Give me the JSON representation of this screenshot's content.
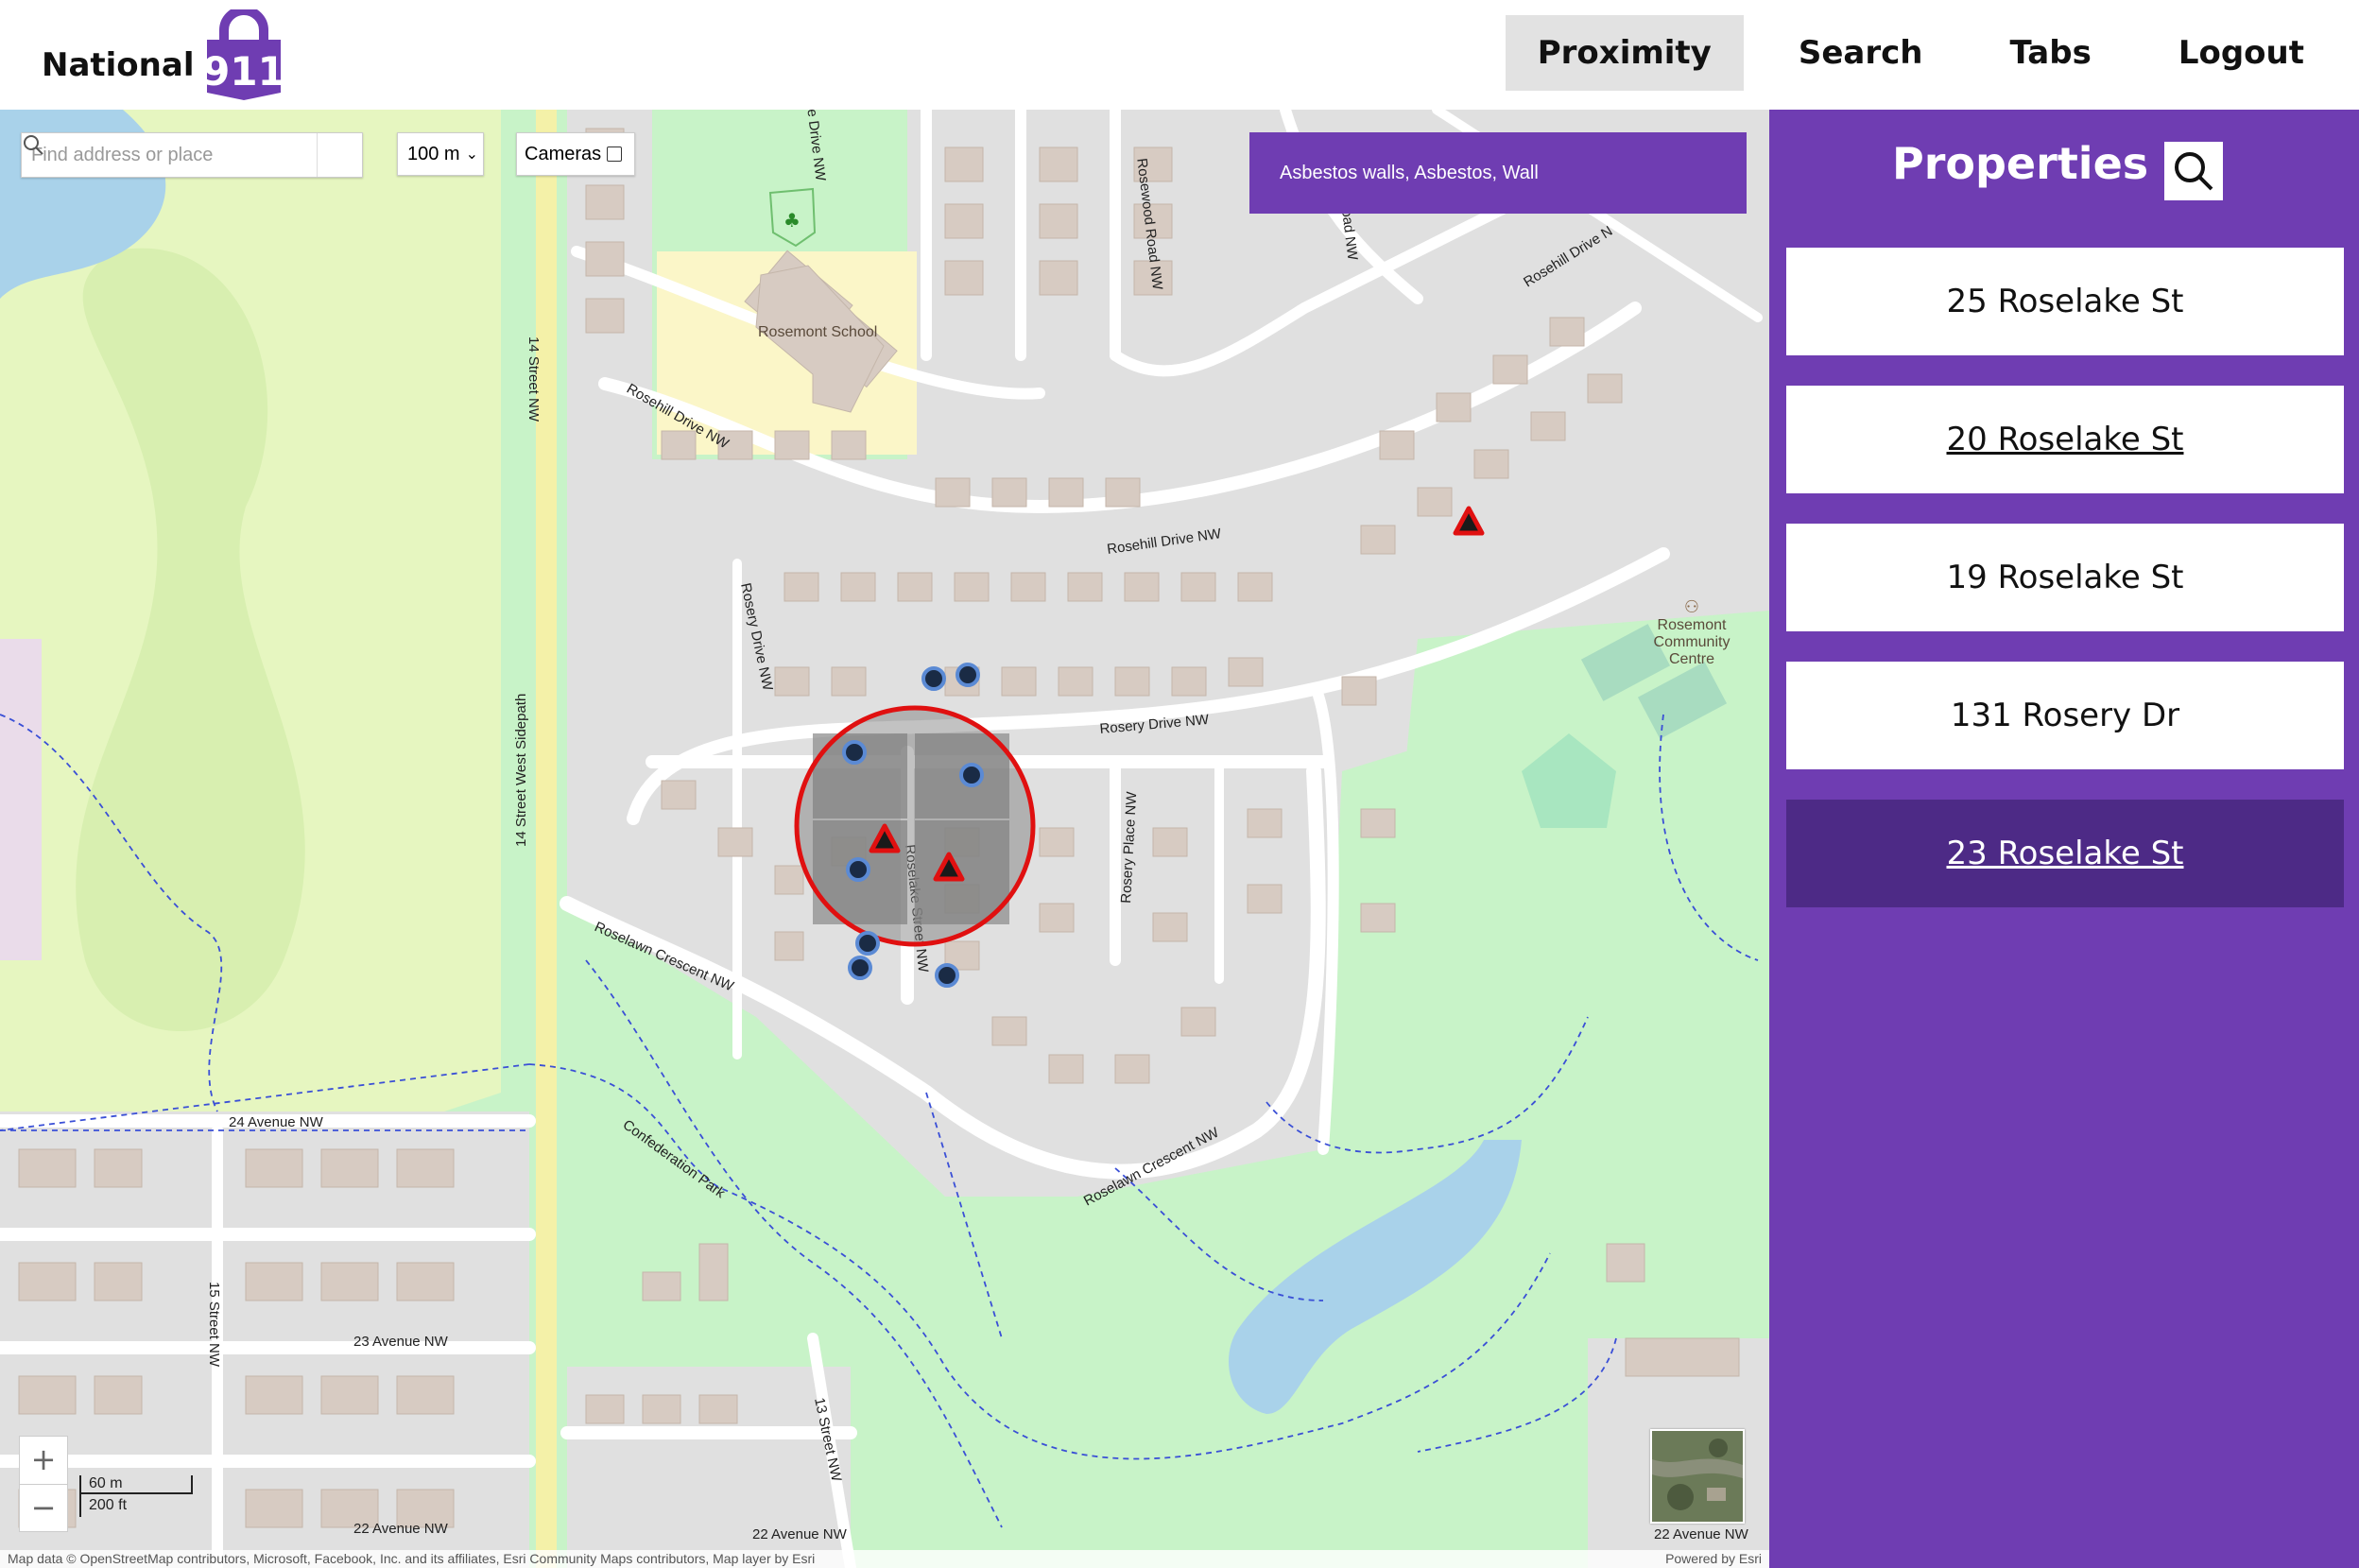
{
  "header": {
    "brand_text": "National",
    "brand_number": "911",
    "nav": [
      {
        "label": "Proximity",
        "active": true
      },
      {
        "label": "Search",
        "active": false
      },
      {
        "label": "Tabs",
        "active": false
      },
      {
        "label": "Logout",
        "active": false
      }
    ]
  },
  "map": {
    "search_placeholder": "Find address or place",
    "radius": "100 m",
    "cameras_label": "Cameras",
    "cameras_checked": false,
    "tooltip": "Asbestos walls, Asbestos, Wall",
    "zoom_in": "+",
    "zoom_out": "−",
    "scale_metric": "60 m",
    "scale_imperial": "200 ft",
    "attribution": "Map data © OpenStreetMap contributors, Microsoft, Facebook, Inc. and its affiliates, Esri Community Maps contributors, Map layer by Esri",
    "powered_by": "Powered by Esri",
    "labels": {
      "rosemont_school": "Rosemont School",
      "rosemont_centre_1": "Rosemont",
      "rosemont_centre_2": "Community",
      "rosemont_centre_3": "Centre",
      "confederation_park": "Confederation Park",
      "roselake_street": "Roselake Street NW",
      "rosery_drive_h": "Rosery Drive NW",
      "rosery_drive_v": "Rosery Drive NW",
      "rosehill_drive_1": "Rosehill Drive NW",
      "rosehill_drive_2": "Rosehill Drive NW",
      "rosehill_drive_3": "Rosehill Drive N",
      "roselawn_crescent_1": "Roselawn Crescent NW",
      "roselawn_crescent_2": "Roselawn Crescent NW",
      "rosery_place": "Rosery Place NW",
      "rosevale_drive": "Rosevale Drive NW",
      "rosewood_road": "Rosewood Road NW",
      "ree_road": "ree Road NW",
      "street_14_nw": "14 Street NW",
      "street_14_sidepath": "14 Street West Sidepath",
      "street_15": "15 Street NW",
      "street_13": "13 Street NW",
      "ave_24": "24 Avenue NW",
      "ave_23": "23 Avenue NW",
      "ave_22_left": "22 Avenue NW",
      "ave_22_mid": "22 Avenue NW",
      "ave_22_right": "22 Avenue NW"
    },
    "colors": {
      "park": "#c8f3c8",
      "golf": "#e6f6c0",
      "water": "#a9d2ea",
      "residential": "#e0e0e0",
      "building": "#d7cbc2",
      "school": "#fbf6c8",
      "marker_circle": "#1a2b45",
      "marker_triangle": "#d62020",
      "radius_ring": "#e01010"
    }
  },
  "sidebar": {
    "title": "Properties",
    "properties": [
      {
        "address": "25 Roselake St",
        "underline": false,
        "selected": false
      },
      {
        "address": "20 Roselake St",
        "underline": true,
        "selected": false
      },
      {
        "address": "19 Roselake St",
        "underline": false,
        "selected": false
      },
      {
        "address": "131 Rosery Dr",
        "underline": false,
        "selected": false
      },
      {
        "address": "23 Roselake St",
        "underline": true,
        "selected": true
      }
    ]
  }
}
